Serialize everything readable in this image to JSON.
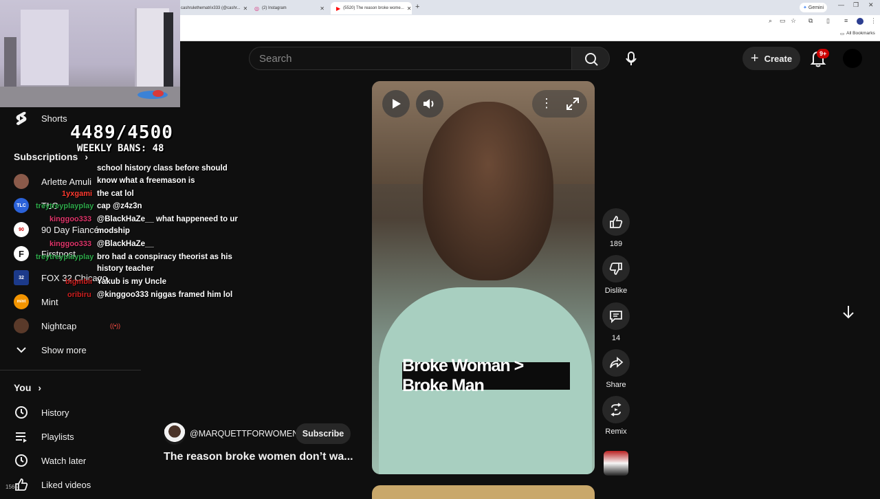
{
  "browser": {
    "tabs": [
      {
        "label": "cashrulethematrix333 (@cashr..."
      },
      {
        "label": "(2) Instagram"
      },
      {
        "label": "(5520) The reason broke wome..."
      }
    ],
    "gemini_label": "Gemini",
    "bookmarks_label": "All Bookmarks"
  },
  "header": {
    "search_placeholder": "Search",
    "create_label": "Create",
    "notification_count": "9+"
  },
  "sidebar": {
    "shorts_label": "Shorts",
    "subscriptions_title": "Subscriptions",
    "subscriptions": [
      {
        "name": "Arlette Amuli",
        "live": false,
        "avatar_color": "#8a5a4a"
      },
      {
        "name": "TLC",
        "live": false,
        "avatar_color": "#2b62d9",
        "avatar_text": "TLC"
      },
      {
        "name": "90 Day Fiancé",
        "live": false,
        "avatar_color": "#ffffff",
        "avatar_text": "90"
      },
      {
        "name": "Firstpost",
        "live": false,
        "avatar_color": "#ffffff",
        "avatar_text": "F"
      },
      {
        "name": "FOX 32 Chicago",
        "live": false,
        "avatar_color": "#1c3a8a",
        "avatar_text": "32"
      },
      {
        "name": "Mint",
        "live": false,
        "avatar_color": "#f29400",
        "avatar_text": "mint"
      },
      {
        "name": "Nightcap",
        "live": true,
        "avatar_color": "#5a3a2a"
      }
    ],
    "show_more_label": "Show more",
    "you_title": "You",
    "you_items": [
      {
        "label": "History"
      },
      {
        "label": "Playlists"
      },
      {
        "label": "Watch later"
      },
      {
        "label": "Liked videos"
      }
    ]
  },
  "overlay": {
    "counter": "4489/4500",
    "weekly_bans": "WEEKLY BANS: 48"
  },
  "chat": {
    "lines": [
      {
        "text": "school history class before should"
      },
      {
        "text": "know what a freemason is"
      },
      {
        "user": "1yxgami",
        "user_color": "#ff3b30",
        "text": "the cat lol"
      },
      {
        "user": "treytreyplayplay",
        "user_color": "#2ea84a",
        "text": "cap @z4z3n"
      },
      {
        "user": "kinggoo333",
        "user_color": "#e0356a",
        "text": "@BlackHaZe__ what happeneed to ur"
      },
      {
        "text": "modship"
      },
      {
        "user": "kinggoo333",
        "user_color": "#e0356a",
        "text": "@BlackHaZe__"
      },
      {
        "user": "treytreyplayplay",
        "user_color": "#2ea84a",
        "text": "bro had a conspiracy theorist as his"
      },
      {
        "text": "history teacher"
      },
      {
        "user": "bigmbii",
        "user_color": "#cc1f1f",
        "text": "Yakub is my Uncle"
      },
      {
        "user": "oribiru",
        "user_color": "#cc1f1f",
        "text": "@kinggoo333 niggas framed him lol"
      }
    ]
  },
  "short": {
    "caption": "Broke Woman > Broke Man",
    "channel": "@MARQUETTFORWOMEN",
    "subscribe_label": "Subscribe",
    "title": "The reason broke women don’t wa...",
    "likes": "189",
    "dislike_label": "Dislike",
    "comments": "14",
    "share_label": "Share",
    "remix_label": "Remix"
  },
  "misc": {
    "bottom_left": "1565"
  }
}
